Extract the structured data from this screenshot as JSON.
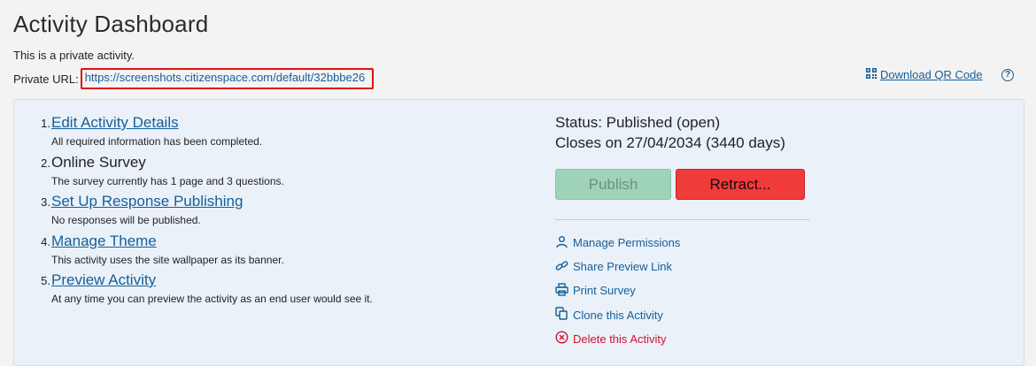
{
  "page": {
    "title": "Activity Dashboard",
    "private_note": "This is a private activity.",
    "private_url_label": "Private URL:",
    "private_url": "https://screenshots.citizenspace.com/default/32bbbe26",
    "qr_label": "Download QR Code",
    "help_glyph": "?"
  },
  "steps": [
    {
      "num": "1.",
      "title": "Edit Activity Details",
      "desc": "All required information has been completed."
    },
    {
      "num": "2.",
      "title": "Online Survey",
      "desc": "The survey currently has 1 page and 3 questions."
    },
    {
      "num": "3.",
      "title": "Set Up Response Publishing",
      "desc": "No responses will be published."
    },
    {
      "num": "4.",
      "title": "Manage Theme",
      "desc": "This activity uses the site wallpaper as its banner."
    },
    {
      "num": "5.",
      "title": "Preview Activity",
      "desc": "At any time you can preview the activity as an end user would see it."
    }
  ],
  "status": {
    "line1": "Status: Published (open)",
    "line2": "Closes on 27/04/2034 (3440 days)",
    "publish_label": "Publish",
    "retract_label": "Retract..."
  },
  "actions": [
    {
      "label": "Manage Permissions",
      "icon": "user-icon"
    },
    {
      "label": "Share Preview Link",
      "icon": "link-icon"
    },
    {
      "label": "Print Survey",
      "icon": "print-icon"
    },
    {
      "label": "Clone this Activity",
      "icon": "clone-icon"
    },
    {
      "label": "Delete this Activity",
      "icon": "delete-icon"
    }
  ],
  "colors": {
    "link": "#155f98",
    "highlight_border": "#e01010",
    "publish_bg": "#9fd3b8",
    "retract_bg": "#f03b3b",
    "danger": "#d2132b",
    "panel_bg": "#eaf1f9"
  }
}
